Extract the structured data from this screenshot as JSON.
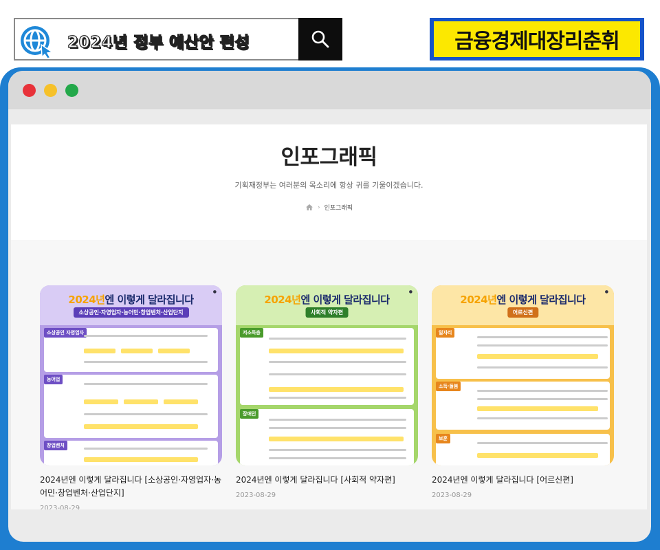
{
  "banner": {
    "search_text": "2024년 정부 예산안 편성",
    "promo_text": "금융경제대장리춘휘"
  },
  "window": {
    "page": {
      "title": "인포그래픽",
      "subtitle": "기획재정부는 여러분의 목소리에 항상 귀를 기울이겠습니다.",
      "breadcrumb": "인포그래픽"
    }
  },
  "cards": [
    {
      "title": "2024년엔 이렇게 달라집니다 [소상공인·자영업자·농어민·창업벤처·산업단지]",
      "date": "2023-08-29",
      "thumb_heading_year": "2024년",
      "thumb_heading_rest": "엔 이렇게 달라집니다",
      "thumb_tag": "소상공인·자영업자·농어민·창업벤처·산업단지",
      "sections": [
        "소상공인 자영업자",
        "농어업",
        "창업벤처"
      ],
      "colors": {
        "bg": "#b59ee6",
        "accent": "#6e4fc4",
        "tag": "#5b3eb8"
      }
    },
    {
      "title": "2024년엔 이렇게 달라집니다 [사회적 약자편]",
      "date": "2023-08-29",
      "thumb_heading_year": "2024년",
      "thumb_heading_rest": "엔 이렇게 달라집니다",
      "thumb_tag": "사회적 약자편",
      "sections": [
        "저소득층",
        "장애인"
      ],
      "colors": {
        "bg": "#a5d66b",
        "accent": "#4a9b2c",
        "tag": "#2f7f2a"
      }
    },
    {
      "title": "2024년엔 이렇게 달라집니다 [어르신편]",
      "date": "2023-08-29",
      "thumb_heading_year": "2024년",
      "thumb_heading_rest": "엔 이렇게 달라집니다",
      "thumb_tag": "어르신편",
      "sections": [
        "일자리",
        "소득·돌봄",
        "보훈"
      ],
      "colors": {
        "bg": "#f7c04a",
        "accent": "#e7861d",
        "tag": "#d0701a"
      }
    }
  ]
}
